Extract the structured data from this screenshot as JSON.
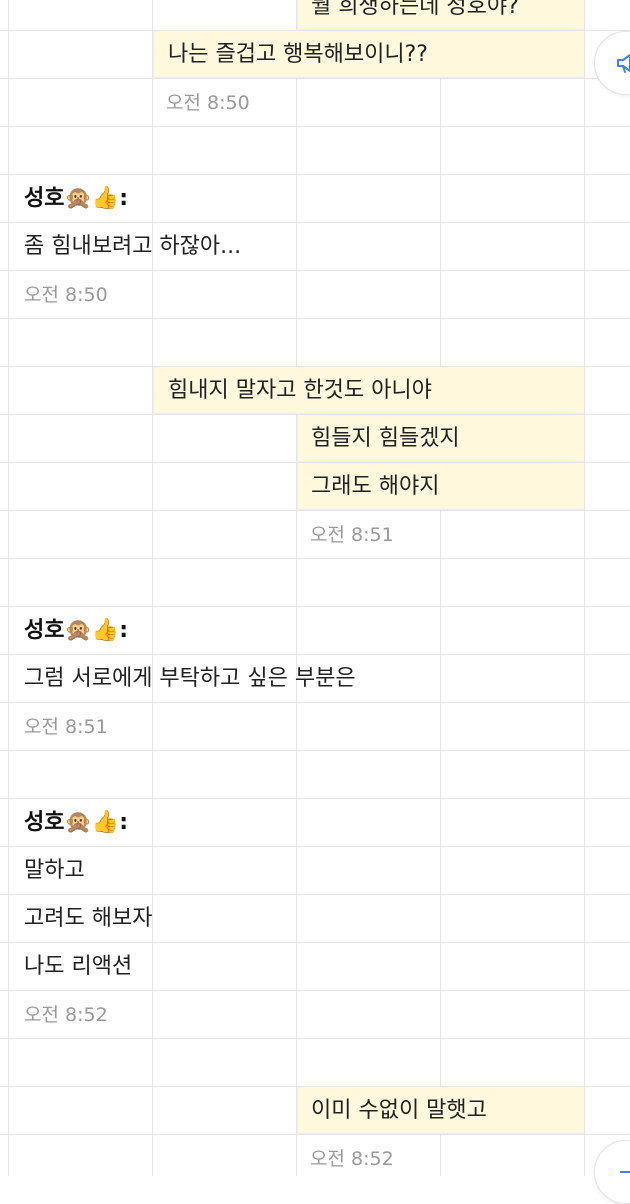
{
  "messages": [
    {
      "kind": "out",
      "text": "뭘 희생하는데 성호야?"
    },
    {
      "kind": "out",
      "text": "나는 즐겁고 행복해보이니??"
    },
    {
      "kind": "time_out",
      "text": "오전 8:50"
    },
    {
      "kind": "sender",
      "text": "성호🙊👍:"
    },
    {
      "kind": "in",
      "text": "좀 힘내보려고 하잖아..."
    },
    {
      "kind": "time_in",
      "text": "오전 8:50"
    },
    {
      "kind": "out",
      "text": "힘내지 말자고 한것도 아니야"
    },
    {
      "kind": "out",
      "text": "힘들지 힘들겠지"
    },
    {
      "kind": "out",
      "text": "그래도 해야지"
    },
    {
      "kind": "time_out",
      "text": "오전 8:51"
    },
    {
      "kind": "sender",
      "text": "성호🙊👍:"
    },
    {
      "kind": "in",
      "text": "그럼 서로에게 부탁하고 싶은 부분은"
    },
    {
      "kind": "time_in",
      "text": "오전 8:51"
    },
    {
      "kind": "sender",
      "text": "성호🙊👍:"
    },
    {
      "kind": "in",
      "text": "말하고"
    },
    {
      "kind": "in",
      "text": "고려도 해보자"
    },
    {
      "kind": "in",
      "text": "나도 리액션"
    },
    {
      "kind": "time_in",
      "text": "오전 8:52"
    },
    {
      "kind": "out",
      "text": "이미 수없이 말햇고"
    },
    {
      "kind": "time_out",
      "text": "오전 8:52"
    }
  ],
  "colors": {
    "outgoing_bubble": "#fff8dc",
    "grid_line": "#e6e6e6",
    "time_text": "#9a9a9a"
  },
  "icons": [
    "megaphone-icon",
    "side-action-icon"
  ]
}
